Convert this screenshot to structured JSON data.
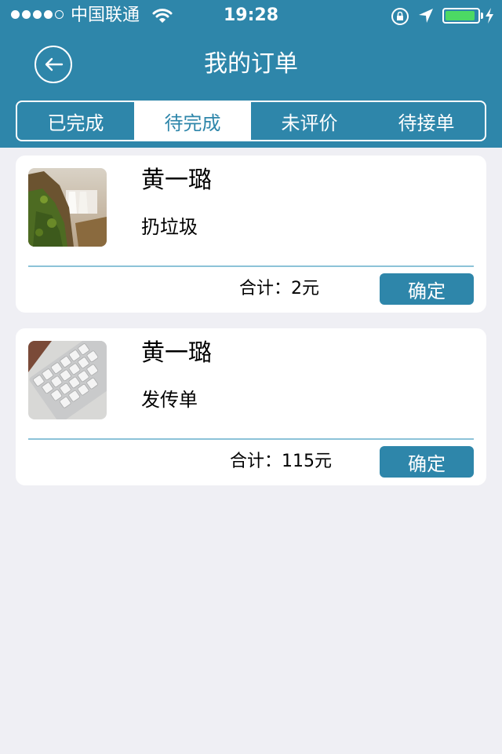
{
  "status_bar": {
    "carrier": "中国联通",
    "time": "19:28",
    "signal_dots": [
      true,
      true,
      true,
      true,
      false
    ],
    "battery_level": 0.92,
    "battery_color": "#4cd964"
  },
  "header": {
    "title": "我的订单",
    "back_icon": "back-arrow-icon"
  },
  "tabs": [
    {
      "label": "已完成",
      "active": false
    },
    {
      "label": "待完成",
      "active": true
    },
    {
      "label": "未评价",
      "active": false
    },
    {
      "label": "待接单",
      "active": false
    }
  ],
  "orders": [
    {
      "name": "黄一璐",
      "service": "扔垃圾",
      "total": "合计：2元",
      "confirm_label": "确定",
      "thumbnail": "waterfall-image"
    },
    {
      "name": "黄一璐",
      "service": "发传单",
      "total": "合计：115元",
      "confirm_label": "确定",
      "thumbnail": "keyboard-image"
    }
  ],
  "colors": {
    "primary": "#2e86aa",
    "background": "#efeff4",
    "divider": "#8cc3d8"
  }
}
